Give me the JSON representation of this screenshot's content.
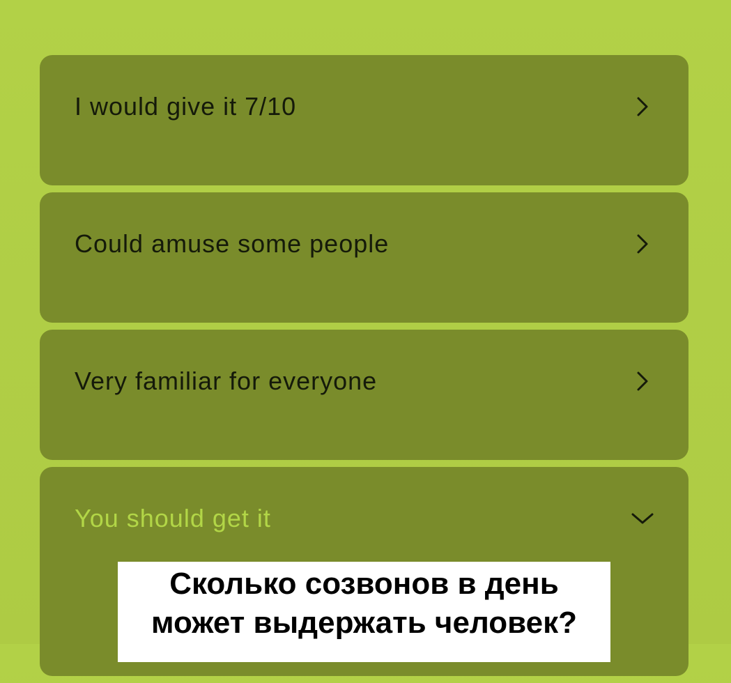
{
  "faq": {
    "items": [
      {
        "label": "I would give it 7/10",
        "state": "collapsed",
        "icon": "chevron-right-icon"
      },
      {
        "label": "Could amuse some people",
        "state": "collapsed",
        "icon": "chevron-right-icon"
      },
      {
        "label": "Very familiar for everyone",
        "state": "collapsed",
        "icon": "chevron-right-icon"
      },
      {
        "label": "You should get it",
        "state": "expanded",
        "icon": "chevron-down-icon"
      }
    ],
    "expanded_content": {
      "line1": "Сколько созвонов  в день",
      "line2": "может выдержать человек?"
    }
  },
  "colors": {
    "page_background": "#b0ce45",
    "item_background": "#7a8c2b",
    "label_text": "#151a0a",
    "active_label_text": "#b2d647",
    "panel_background": "#ffffff"
  }
}
